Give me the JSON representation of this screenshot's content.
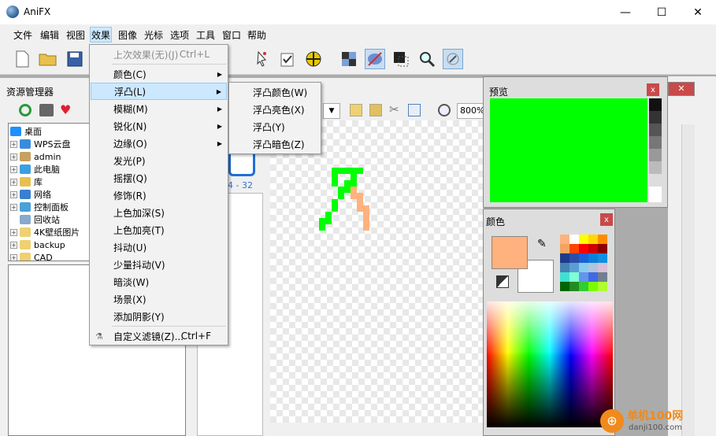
{
  "window": {
    "title": "AniFX",
    "minimize": "—",
    "maximize": "☐",
    "close": "✕"
  },
  "menubar": [
    "文件",
    "编辑",
    "视图",
    "效果",
    "图像",
    "光标",
    "选项",
    "工具",
    "窗口",
    "帮助"
  ],
  "active_menu": "效果",
  "left_panel": {
    "title": "资源管理器"
  },
  "tree": [
    {
      "label": "桌面",
      "color": "#1e90ff"
    },
    {
      "label": "WPS云盘",
      "color": "#3b8bdc"
    },
    {
      "label": "admin",
      "color": "#c8a060"
    },
    {
      "label": "此电脑",
      "color": "#3aa0e0"
    },
    {
      "label": "库",
      "color": "#e8c050"
    },
    {
      "label": "网络",
      "color": "#3a7fd0"
    },
    {
      "label": "控制面板",
      "color": "#4aa0d8"
    },
    {
      "label": "回收站",
      "color": "#88aacc"
    },
    {
      "label": "4K壁纸图片",
      "color": "#f0d070"
    },
    {
      "label": "backup",
      "color": "#f0d070"
    },
    {
      "label": "CAD",
      "color": "#f0d070"
    }
  ],
  "canvas": {
    "zoom": "800%",
    "frame_label": "4 - 32"
  },
  "effects_menu": [
    {
      "label": "上次效果(无)(J)",
      "shortcut": "Ctrl+L",
      "disabled": true
    },
    {
      "label": "颜色(C)",
      "submenu": true
    },
    {
      "label": "浮凸(L)",
      "submenu": true,
      "highlighted": true
    },
    {
      "label": "模糊(M)",
      "submenu": true
    },
    {
      "label": "锐化(N)",
      "submenu": true
    },
    {
      "label": "边缘(O)",
      "submenu": true
    },
    {
      "label": "发光(P)"
    },
    {
      "label": "摇摆(Q)"
    },
    {
      "label": "修饰(R)"
    },
    {
      "label": "上色加深(S)"
    },
    {
      "label": "上色加亮(T)"
    },
    {
      "label": "抖动(U)"
    },
    {
      "label": "少量抖动(V)"
    },
    {
      "label": "暗淡(W)"
    },
    {
      "label": "场景(X)"
    },
    {
      "label": "添加阴影(Y)"
    },
    {
      "label": "自定义滤镜(Z)...",
      "shortcut": "Ctrl+F"
    }
  ],
  "emboss_submenu": [
    "浮凸颜色(W)",
    "浮凸亮色(X)",
    "浮凸(Y)",
    "浮凸暗色(Z)"
  ],
  "preview_panel": {
    "title": "预览",
    "close": "x",
    "fill": "#00ff00"
  },
  "color_panel": {
    "title": "颜色",
    "close": "x",
    "primary": "#ffb27d",
    "secondary": "#ffffff"
  },
  "palette": [
    "#ffb27d",
    "#ffffff",
    "#ffff00",
    "#ffd700",
    "#ff8c00",
    "#f4a460",
    "#ff4500",
    "#ff0000",
    "#cc0000",
    "#8b0000",
    "#1e3a8a",
    "#2b4fa8",
    "#1e5fd8",
    "#0a7fd8",
    "#1090e0",
    "#4682b4",
    "#5a9fd4",
    "#87ceeb",
    "#b0c4de",
    "#d8bfd8",
    "#40e0d0",
    "#7fffd4",
    "#6495ed",
    "#4169e1",
    "#708090",
    "#006400",
    "#228b22",
    "#32cd32",
    "#7cfc00",
    "#adff2f"
  ],
  "gray_strip": [
    "#111111",
    "#333333",
    "#555555",
    "#777777",
    "#999999",
    "#bbbbbb",
    "#dddddd",
    "#ffffff"
  ],
  "watermark": {
    "text": "单机100网",
    "url": "danji100.com"
  }
}
